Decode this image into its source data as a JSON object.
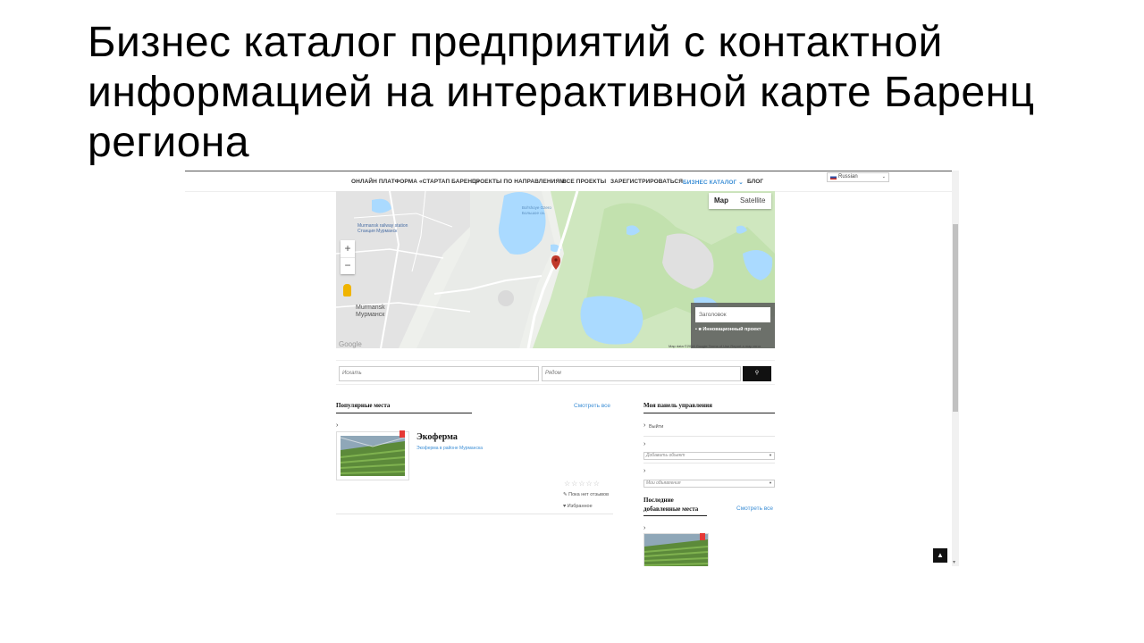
{
  "slide": {
    "title": "Бизнес каталог предприятий с контактной информацией на интерактивной карте Баренц региона"
  },
  "nav": {
    "items": [
      {
        "label": "ОНЛАЙН ПЛАТФОРМА «СТАРТАП БАРЕНЦ»"
      },
      {
        "label": "ПРОЕКТЫ ПО НАПРАВЛЕНИЯМ"
      },
      {
        "label": "ВСЕ ПРОЕКТЫ"
      },
      {
        "label": "ЗАРЕГИСТРИРОВАТЬСЯ"
      },
      {
        "label": "БИЗНЕС КАТАЛОГ ⌄",
        "active": true
      },
      {
        "label": "БЛОГ"
      }
    ],
    "language": "Russian"
  },
  "map": {
    "type_buttons": {
      "map": "Map",
      "satellite": "Satellite"
    },
    "zoom_in": "+",
    "zoom_out": "−",
    "labels": {
      "city_en": "Murmansk",
      "city_ru": "Мурманск",
      "station_en": "Murmansk railway station",
      "station_ru": "Станция Мурманск",
      "lake_en": "Bol'shoye Ozero",
      "lake_ru": "Большое оз."
    },
    "filter_placeholder": "Заголовок",
    "filter_category": "Инновационный проект",
    "attribution": "Map data ©2018 Google    Terms of Use    Report a map error",
    "google": "Google"
  },
  "search": {
    "keyword_placeholder": "Искать",
    "near_placeholder": "Рядом",
    "button_icon": "search-icon"
  },
  "popular": {
    "title": "Популярные места",
    "see_all": "Смотреть все",
    "item": {
      "title": "Экоферма",
      "subtitle": "Экоферма в районе Мурманска",
      "reviews": "Пока нет отзывов",
      "favorite": "Избранное"
    }
  },
  "dashboard": {
    "title": "Моя панель управления",
    "logout": "Выйти",
    "add_listing": "Добавить объект",
    "my_listings": "Мои объявления"
  },
  "recent": {
    "title_line1": "Последние",
    "title_line2": "добавленные места",
    "see_all": "Смотреть все"
  },
  "colors": {
    "accent": "#3d8fd6",
    "badge": "#e53935",
    "water": "#aadaff",
    "park": "#c8e6b8"
  }
}
